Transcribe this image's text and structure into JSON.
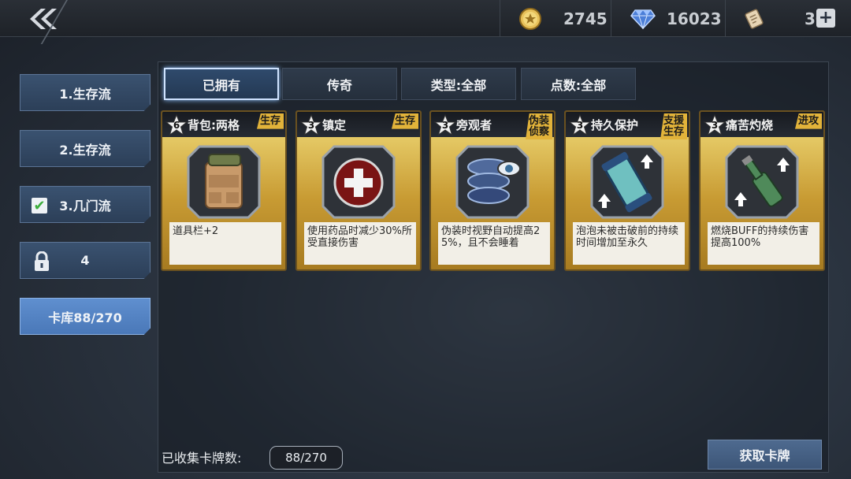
{
  "header": {
    "back_icon": "double-chevron-left-icon",
    "gold": "2745",
    "gems": "16023",
    "tickets": "30",
    "plus_label": "+"
  },
  "sidebar": {
    "items": [
      {
        "label": "1.生存流",
        "state": "normal"
      },
      {
        "label": "2.生存流",
        "state": "normal"
      },
      {
        "label": "3.几门流",
        "state": "checked"
      },
      {
        "label": "4",
        "state": "locked"
      },
      {
        "label": "卡库88/270",
        "state": "active"
      }
    ]
  },
  "tabs": [
    {
      "label": "已拥有",
      "active": true
    },
    {
      "label": "传奇",
      "active": false
    },
    {
      "label": "类型:全部",
      "active": false
    },
    {
      "label": "点数:全部",
      "active": false
    }
  ],
  "cards": [
    {
      "cost": "6",
      "name": "背包:两格",
      "tag": "生存",
      "icon": "backpack-icon",
      "desc": "道具栏+2"
    },
    {
      "cost": "3",
      "name": "镇定",
      "tag": "生存",
      "icon": "medical-cross-icon",
      "desc": "使用药品时减少30%所受直接伤害"
    },
    {
      "cost": "3",
      "name": "旁观者",
      "tag": "伪装\n侦察",
      "icon": "eye-tires-icon",
      "desc": "伪装时视野自动提高25%，且不会睡着"
    },
    {
      "cost": "3",
      "name": "持久保护",
      "tag": "支援\n生存",
      "icon": "bubble-canister-icon",
      "desc": "泡泡未被击破前的持续时间增加至永久"
    },
    {
      "cost": "3",
      "name": "痛苦灼烧",
      "tag": "进攻",
      "icon": "molotov-bottle-icon",
      "desc": "燃烧BUFF的持续伤害提高100%"
    }
  ],
  "footer": {
    "collected_label": "已收集卡牌数:",
    "collected_value": "88/270",
    "get_cards_button": "获取卡牌"
  }
}
